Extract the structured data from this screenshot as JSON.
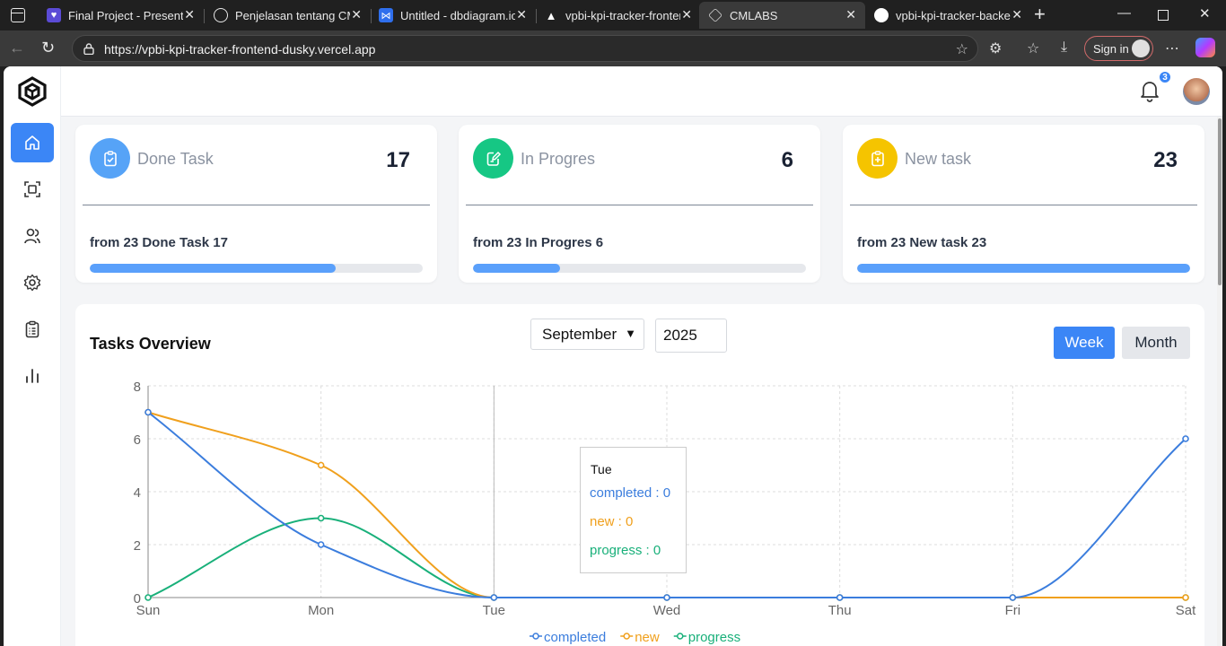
{
  "browser": {
    "tabs": [
      {
        "title": "Final Project - Presentation",
        "fav_color": "#5b4bd6",
        "active": false
      },
      {
        "title": "Penjelasan tentang CMLABS",
        "fav_color": "#202020",
        "active": false
      },
      {
        "title": "Untitled - dbdiagram.io",
        "fav_color": "#2f6fed",
        "active": false
      },
      {
        "title": "vpbi-kpi-tracker-frontend",
        "fav_color": "#000000",
        "active": false
      },
      {
        "title": "CMLABS",
        "fav_color": "#3a3a3a",
        "active": true
      },
      {
        "title": "vpbi-kpi-tracker-backend",
        "fav_color": "#202020",
        "active": false
      }
    ],
    "url": "https://vpbi-kpi-tracker-frontend-dusky.vercel.app",
    "signin_label": "Sign in"
  },
  "topbar": {
    "notification_count": "3"
  },
  "sidebar": {
    "items": [
      {
        "name": "home-icon",
        "active": true
      },
      {
        "name": "scan-icon",
        "active": false
      },
      {
        "name": "users-icon",
        "active": false
      },
      {
        "name": "gear-icon",
        "active": false
      },
      {
        "name": "clipboard-list-icon",
        "active": false
      },
      {
        "name": "bar-chart-icon",
        "active": false
      }
    ]
  },
  "cards": [
    {
      "title": "Done Task",
      "count": "17",
      "subtitle": "from 23 Done Task 17",
      "progress": 0.739,
      "icon_color": "#56a3f7",
      "icon": "clipboard-check-icon"
    },
    {
      "title": "In Progres",
      "count": "6",
      "subtitle": "from 23 In Progres 6",
      "progress": 0.261,
      "icon_color": "#16c784",
      "icon": "edit-icon"
    },
    {
      "title": "New task",
      "count": "23",
      "subtitle": "from 23 New task 23",
      "progress": 1.0,
      "icon_color": "#f5c400",
      "icon": "clipboard-plus-icon"
    }
  ],
  "overview": {
    "title": "Tasks Overview",
    "month": "September",
    "year": "2025",
    "week_label": "Week",
    "month_label": "Month"
  },
  "chart_data": {
    "type": "line",
    "categories": [
      "Sun",
      "Mon",
      "Tue",
      "Wed",
      "Thu",
      "Fri",
      "Sat"
    ],
    "ylim": [
      0,
      8
    ],
    "yticks": [
      "0",
      "2",
      "4",
      "6",
      "8"
    ],
    "grid": true,
    "legend_position": "bottom",
    "series": [
      {
        "name": "completed",
        "color": "#3b7ddd",
        "values": [
          7,
          2,
          0,
          0,
          0,
          0,
          6
        ]
      },
      {
        "name": "new",
        "color": "#f0a01d",
        "values": [
          7,
          5,
          0,
          0,
          0,
          0,
          0
        ]
      },
      {
        "name": "progress",
        "color": "#19b07a",
        "values": [
          0,
          3,
          0,
          0,
          0,
          0,
          0
        ]
      }
    ],
    "tooltip": {
      "day": "Tue",
      "completed": "completed : 0",
      "new": "new : 0",
      "progress": "progress : 0"
    }
  }
}
